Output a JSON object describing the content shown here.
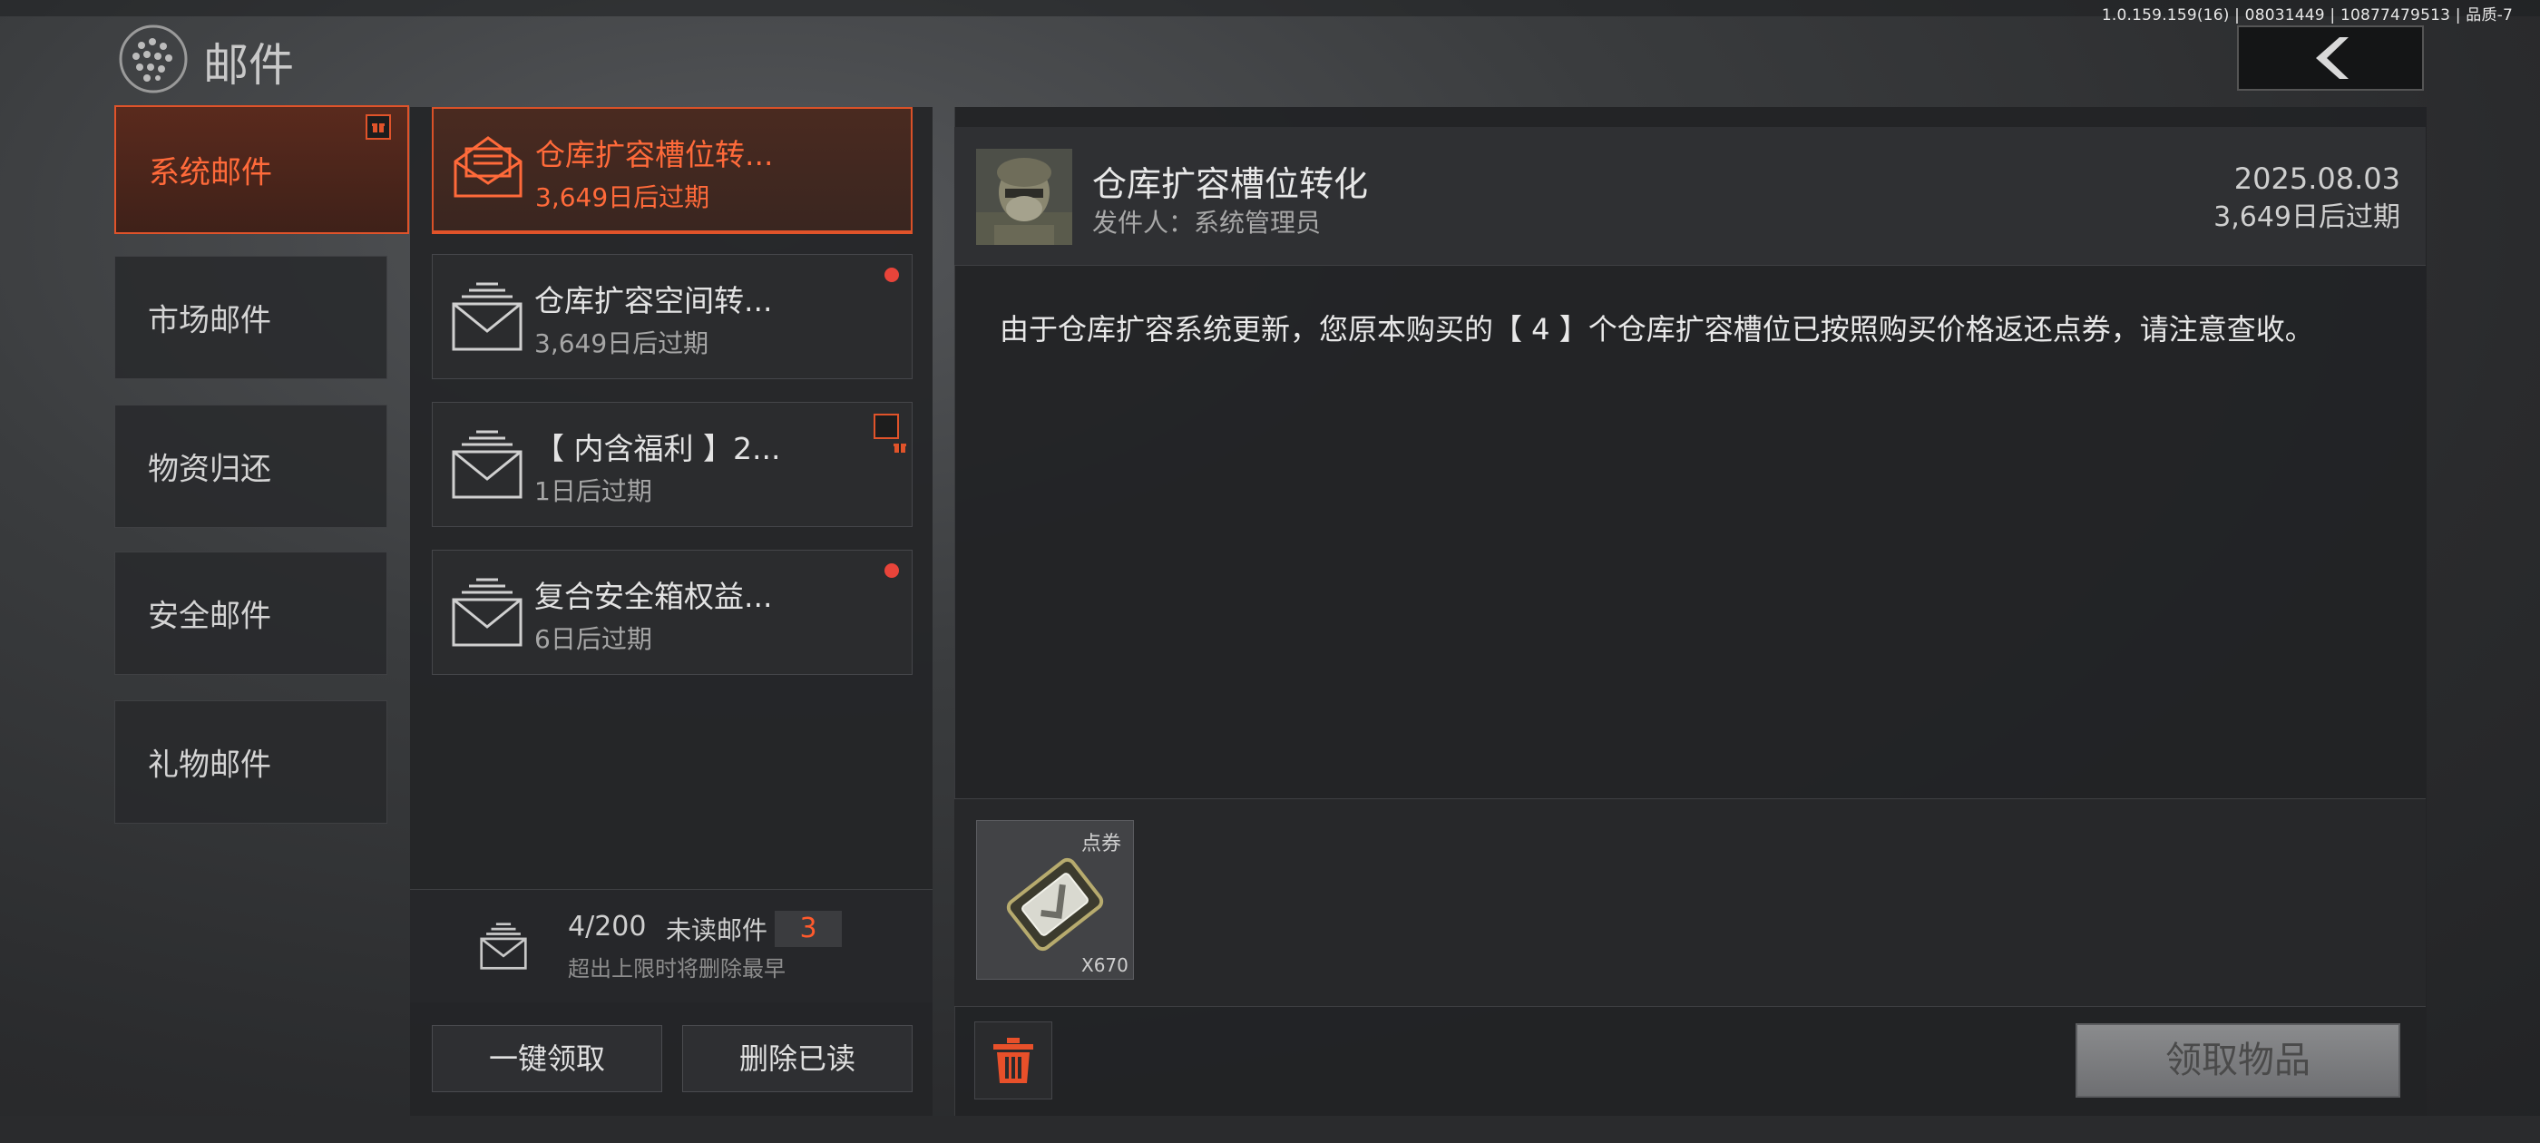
{
  "header": {
    "version": "1.0.159.159(16) | 08031449 | 10877479513 | 品质-7",
    "title": "邮件"
  },
  "categories": [
    {
      "label": "系统邮件",
      "active": true,
      "gift": true
    },
    {
      "label": "市场邮件"
    },
    {
      "label": "物资归还"
    },
    {
      "label": "安全邮件"
    },
    {
      "label": "礼物邮件"
    }
  ],
  "mails": [
    {
      "title": "仓库扩容槽位转...",
      "expire": "3,649日后过期",
      "active": true
    },
    {
      "title": "仓库扩容空间转...",
      "expire": "3,649日后过期",
      "unread": true
    },
    {
      "title": "【 内含福利 】2...",
      "expire": "1日后过期",
      "gift": true
    },
    {
      "title": "复合安全箱权益...",
      "expire": "6日后过期",
      "unread": true
    }
  ],
  "footer": {
    "count": "4/200",
    "unread_label": "未读邮件",
    "unread_count": "3",
    "limit_note": "超出上限时将删除最早",
    "claim_all": "一键领取",
    "delete_read": "删除已读"
  },
  "detail": {
    "title": "仓库扩容槽位转化",
    "sender": "发件人：系统管理员",
    "date": "2025.08.03",
    "expire": "3,649日后过期",
    "body": "由于仓库扩容系统更新，您原本购买的【 4 】个仓库扩容槽位已按照购买价格返还点券，请注意查收。",
    "reward_name": "点券",
    "reward_qty": "X670",
    "claim_button": "领取物品"
  },
  "colors": {
    "accent": "#e0532a",
    "unread_dot": "#e8443a"
  }
}
